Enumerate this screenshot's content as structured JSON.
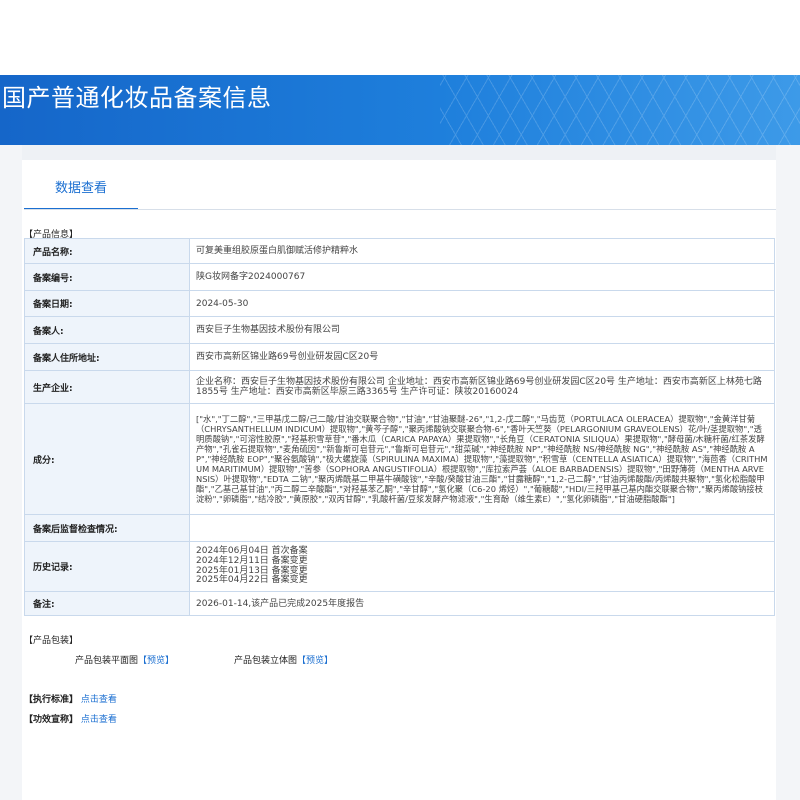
{
  "header": {
    "title": "国产普通化妆品备案信息"
  },
  "tab": {
    "label": "数据查看"
  },
  "product_info": {
    "section_title": "【产品信息】",
    "rows": [
      {
        "label": "产品名称:",
        "value": "可复美重组胶原蛋白肌御赋活修护精粹水"
      },
      {
        "label": "备案编号:",
        "value": "陕G妆网备字2024000767"
      },
      {
        "label": "备案日期:",
        "value": "2024-05-30"
      },
      {
        "label": "备案人:",
        "value": "西安巨子生物基因技术股份有限公司"
      },
      {
        "label": "备案人住所地址:",
        "value": "西安市高新区锦业路69号创业研发园C区20号"
      },
      {
        "label": "生产企业:",
        "value": "企业名称：西安巨子生物基因技术股份有限公司 企业地址：西安市高新区锦业路69号创业研发园C区20号 生产地址：西安市高新区上林苑七路1855号 生产地址：西安市高新区毕原三路3365号 生产许可证：陕妆20160024"
      },
      {
        "label": "成分:",
        "value": "[\"水\",\"丁二醇\",\"三甲基戊二醇/己二酸/甘油交联聚合物\",\"甘油\",\"甘油聚醚-26\",\"1,2-戊二醇\",\"马齿苋（PORTULACA OLERACEA）提取物\",\"金黄洋甘菊（CHRYSANTHELLUM INDICUM）提取物\",\"黄芩子醇\",\"聚丙烯酸钠交联聚合物-6\",\"香叶天竺葵（PELARGONIUM GRAVEOLENS）花/叶/茎提取物\",\"透明质酸钠\",\"可溶性胶原\",\"羟基积雪草苷\",\"番木瓜（CARICA PAPAYA）果提取物\",\"长角豆（CERATONIA SILIQUA）果提取物\",\"酵母菌/木糖杆菌/红茶发酵产物\",\"孔雀石提取物\",\"麦角硫因\",\"新鲁斯可皂苷元\",\"鲁斯可皂苷元\",\"甜菜碱\",\"神经酰胺 NP\",\"神经酰胺 NS/神经酰胺 NG\",\"神经酰胺 AS\",\"神经酰胺 AP\",\"神经酰胺 EOP\",\"聚谷氨酸钠\",\"极大螺旋藻（SPIRULINA MAXIMA）提取物\",\"藻提取物\",\"积雪草（CENTELLA ASIATICA）提取物\",\"海茴香（CRITHMUM MARITIMUM）提取物\",\"苦参（SOPHORA ANGUSTIFOLIA）根提取物\",\"库拉索芦荟（ALOE BARBADENSIS）提取物\",\"田野薄荷（MENTHA ARVENSIS）叶提取物\",\"EDTA 二钠\",\"聚丙烯酰基二甲基牛磺酸铵\",\"辛酸/癸酸甘油三酯\",\"甘露糖醇\",\"1,2-己二醇\",\"甘油丙烯酸酯/丙烯酸共聚物\",\"氢化松脂酸甲酯\",\"乙基己基甘油\",\"丙二醇二辛酸酯\",\"对羟基苯乙酮\",\"辛甘醇\",\"氢化聚（C6-20 烯烃）\",\"葡糖酸\",\"HDI/三羟甲基己基内酯交联聚合物\",\"聚丙烯酸钠接枝淀粉\",\"卵磷脂\",\"结冷胶\",\"黄原胶\",\"双丙甘醇\",\"乳酸杆菌/豆浆发酵产物滤液\",\"生育酚（维生素E）\",\"氢化卵磷脂\",\"甘油硬脂酸酯\"]"
      },
      {
        "label": "备案后监督检查情况:",
        "value": ""
      },
      {
        "label": "历史记录:",
        "history": [
          "2024年06月04日 首次备案",
          "2024年12月11日 备案变更",
          "2025年01月13日 备案变更",
          "2025年04月22日 备案变更"
        ]
      },
      {
        "label": "备注:",
        "value": "2026-01-14,该产品已完成2025年度报告"
      }
    ]
  },
  "packaging": {
    "section_title": "【产品包装】",
    "flat_label": "产品包装平面图",
    "flat_link": "【预览】",
    "stereo_label": "产品包装立体图",
    "stereo_link": "【预览】"
  },
  "standard": {
    "section_title": "【执行标准】",
    "link": "点击查看"
  },
  "claims": {
    "section_title": "【功效宣称】",
    "link": "点击查看"
  }
}
